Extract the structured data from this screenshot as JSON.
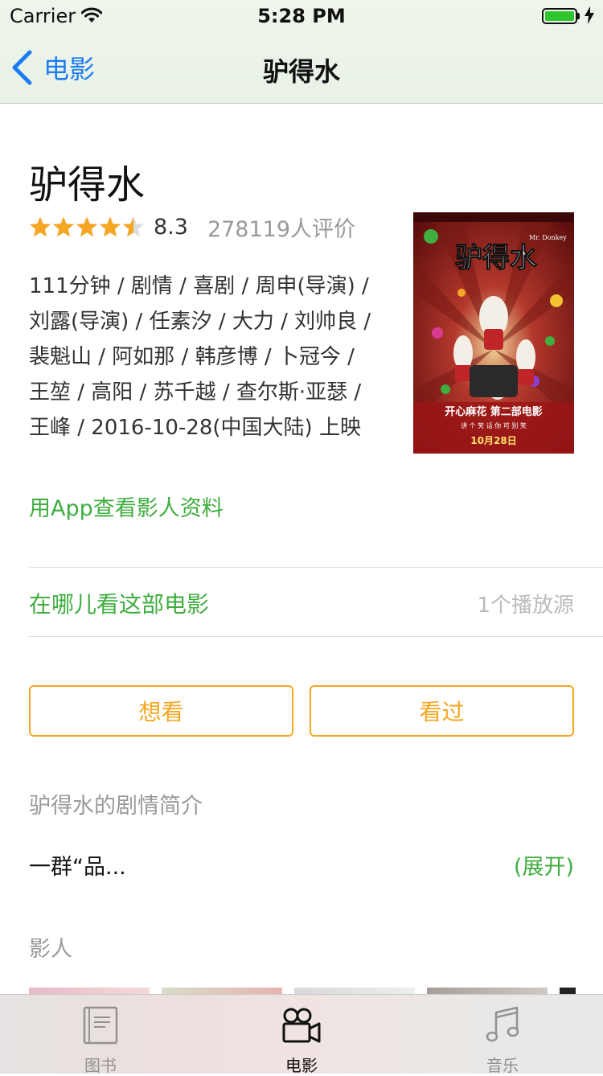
{
  "status_bar": {
    "carrier": "Carrier",
    "time": "5:28 PM",
    "battery_percent": 100
  },
  "nav": {
    "back_label": "电影",
    "title": "驴得水"
  },
  "movie": {
    "title": "驴得水",
    "rating_stars": 4.5,
    "score": "8.3",
    "rating_count": "278119人评价",
    "meta": "111分钟 / 剧情 / 喜剧 / 周申(导演) / 刘露(导演) / 任素汐 / 大力 / 刘帅良 / 裴魁山 / 阿如那 / 韩彦博 / 卜冠今 / 王堃 / 高阳 / 苏千越 / 查尔斯·亚瑟 / 王峰 / 2016-10-28(中国大陆) 上映",
    "app_link": "用App查看影人资料",
    "poster": {
      "title_art": "驴得水",
      "english": "Mr. Donkey",
      "tagline": "开心麻花 第二部电影",
      "slogan": "讲 个 笑 话   你 可 别 笑",
      "release": "10月28日"
    }
  },
  "watch": {
    "label": "在哪儿看这部电影",
    "count": "1个播放源"
  },
  "actions": {
    "want": "想看",
    "seen": "看过"
  },
  "summary": {
    "heading": "驴得水的剧情简介",
    "text": "一群“品...",
    "expand": "(展开)"
  },
  "cast": {
    "heading": "影人"
  },
  "tabbar": {
    "active": "电影",
    "items": [
      {
        "label": "图书",
        "icon": "book-icon"
      },
      {
        "label": "电影",
        "icon": "movie-camera-icon"
      },
      {
        "label": "音乐",
        "icon": "music-note-icon"
      }
    ]
  },
  "colors": {
    "accent_blue": "#1b7df5",
    "green": "#3fae3f",
    "orange": "#f5a623",
    "star": "#f5a623"
  }
}
